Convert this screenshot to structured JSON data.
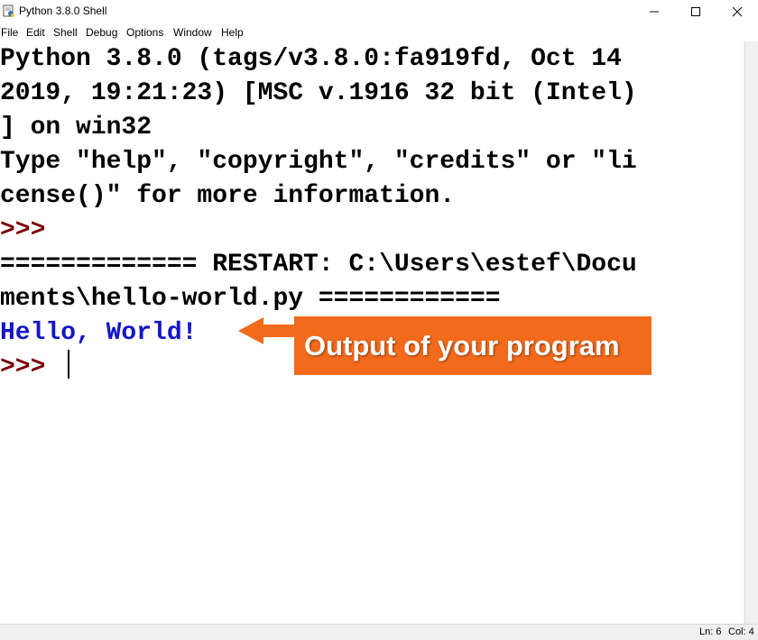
{
  "window": {
    "title": "Python 3.8.0 Shell",
    "icon": "python-idle-icon",
    "controls": [
      "minimize-icon",
      "maximize-icon",
      "close-icon"
    ]
  },
  "menu": {
    "items": [
      "File",
      "Edit",
      "Shell",
      "Debug",
      "Options",
      "Window",
      "Help"
    ]
  },
  "shell": {
    "lines": [
      "Python 3.8.0 (tags/v3.8.0:fa919fd, Oct 14",
      "2019, 19:21:23) [MSC v.1916 32 bit (Intel)",
      "] on win32",
      "Type \"help\", \"copyright\", \"credits\" or \"li",
      "cense()\" for more information."
    ],
    "prompt": ">>>",
    "restart_lines": [
      "============= RESTART: C:\\Users\\estef\\Docu",
      "ments\\hello-world.py ============"
    ],
    "output": "Hello, World!",
    "final_prompt": ">>> "
  },
  "status": {
    "line": "Ln: 6",
    "col": "Col: 4"
  },
  "annotation": {
    "text": "Output of your program"
  },
  "colors": {
    "prompt": "#7a0000",
    "output": "#1515c8",
    "callout": "#f26a1b"
  }
}
